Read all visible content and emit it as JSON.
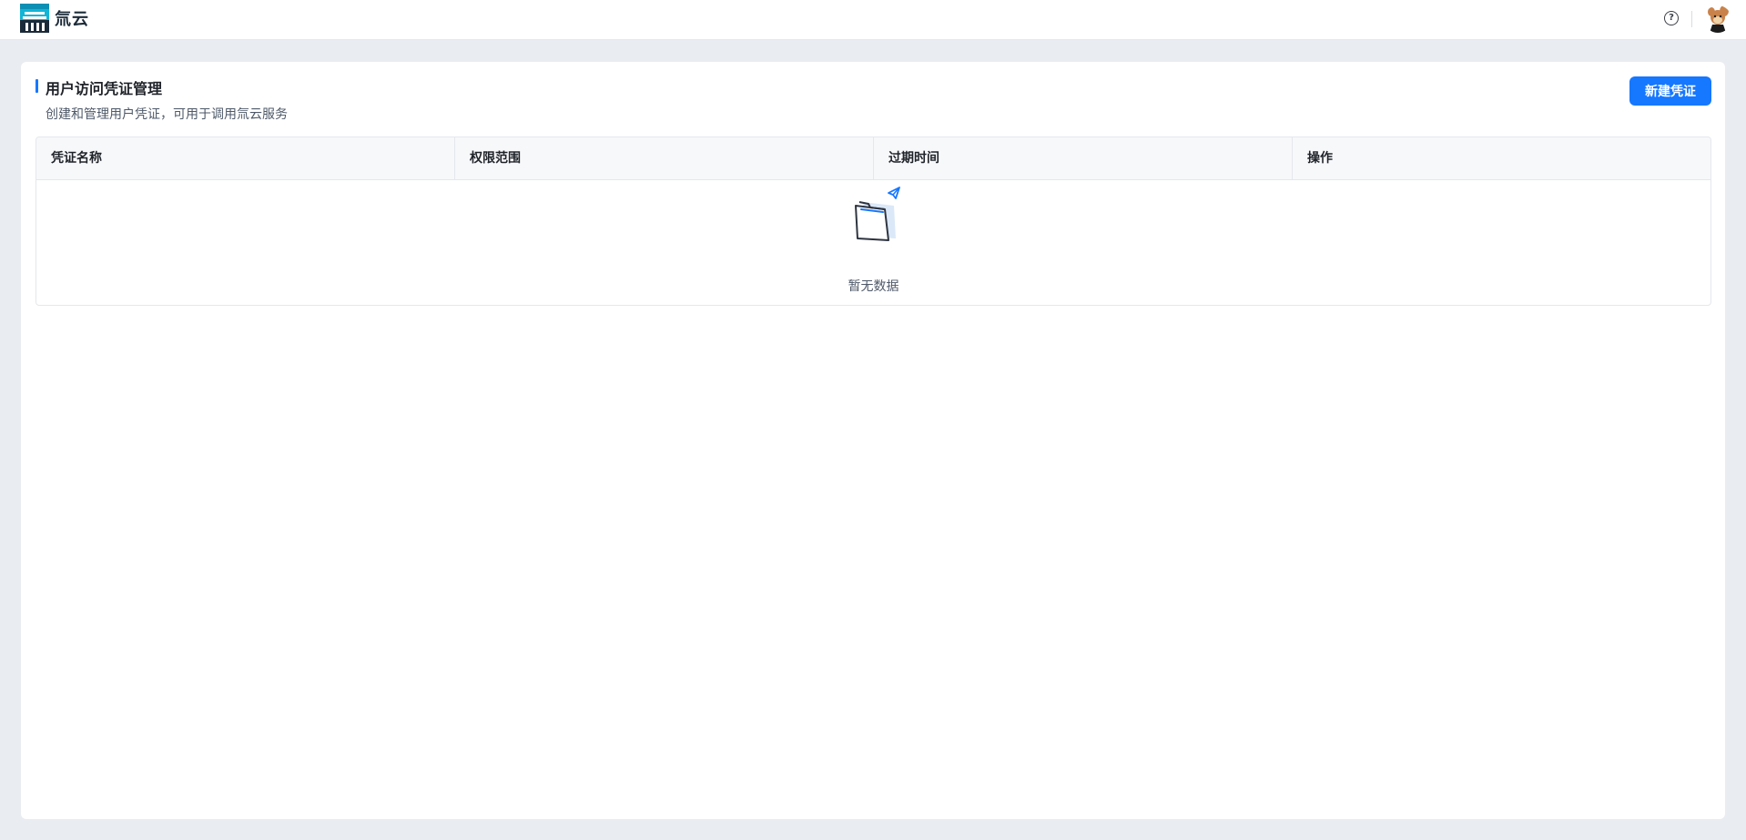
{
  "app": {
    "name": "氚云"
  },
  "header": {
    "help_icon": "question-circle-icon",
    "avatar_icon": "user-avatar"
  },
  "page": {
    "title": "用户访问凭证管理",
    "subtitle": "创建和管理用户凭证，可用于调用氚云服务",
    "new_button_label": "新建凭证"
  },
  "table": {
    "columns": [
      "凭证名称",
      "权限范围",
      "过期时间",
      "操作"
    ],
    "rows": [],
    "empty_text": "暂无数据"
  },
  "colors": {
    "primary": "#1677ff",
    "page_bg": "#e9ecf1"
  }
}
